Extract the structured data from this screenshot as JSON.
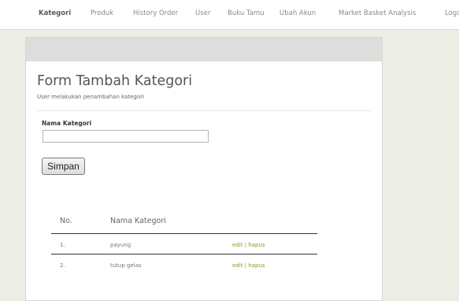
{
  "nav": {
    "items": [
      {
        "label": "Kategori"
      },
      {
        "label": "Produk"
      },
      {
        "label": "History Order"
      },
      {
        "label": "User"
      },
      {
        "label": "Buku Tamu"
      },
      {
        "label": "Ubah Akun"
      },
      {
        "label": "Market Basket Analysis"
      },
      {
        "label": "Logout"
      }
    ],
    "active": "Kategori"
  },
  "form": {
    "title": "Form Tambah Kategori",
    "subtitle": "User melakukan penambahan kategori",
    "field_label": "Nama Kategori",
    "field_value": "",
    "submit_label": "Simpan"
  },
  "table": {
    "headers": [
      "No.",
      "Nama Kategori"
    ],
    "rows": [
      {
        "no": "1.",
        "name": "payung",
        "edit": "edit",
        "sep": "|",
        "delete": "hapus"
      },
      {
        "no": "2.",
        "name": "tutup gelas",
        "edit": "edit",
        "sep": "|",
        "delete": "hapus"
      }
    ]
  },
  "colors": {
    "background": "#eceee5",
    "link": "#8a9a2a"
  }
}
